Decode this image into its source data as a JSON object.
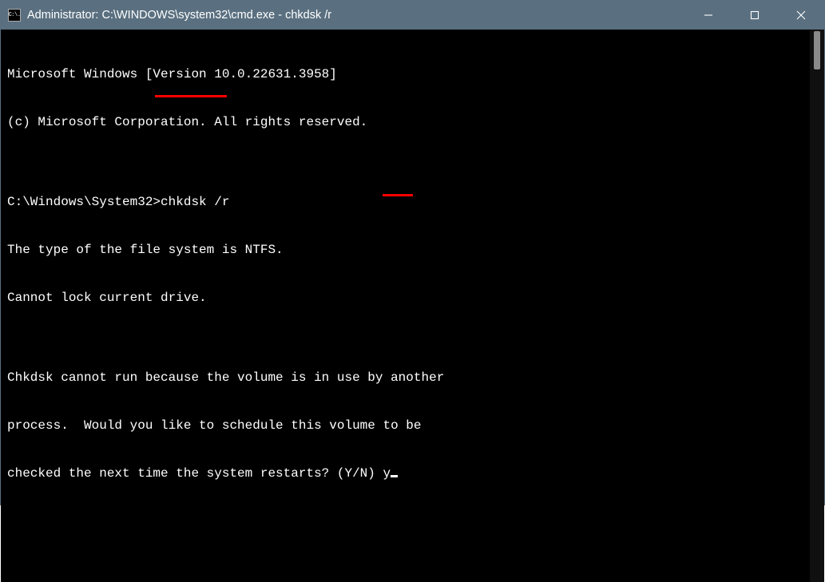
{
  "titlebar": {
    "icon_text": "C:\\.",
    "title": "Administrator: C:\\WINDOWS\\system32\\cmd.exe - chkdsk  /r"
  },
  "terminal": {
    "line1": "Microsoft Windows [Version 10.0.22631.3958]",
    "line2": "(c) Microsoft Corporation. All rights reserved.",
    "blank1": "",
    "prompt": "C:\\Windows\\System32>",
    "command": "chkdsk /r",
    "line4": "The type of the file system is NTFS.",
    "line5": "Cannot lock current drive.",
    "blank2": "",
    "line6": "Chkdsk cannot run because the volume is in use by another",
    "line7": "process.  Would you like to schedule this volume to be",
    "line8a": "checked the next time the system restarts? (Y/N) ",
    "response": "y"
  },
  "annotations": {
    "underline_command": true,
    "underline_response": true
  }
}
